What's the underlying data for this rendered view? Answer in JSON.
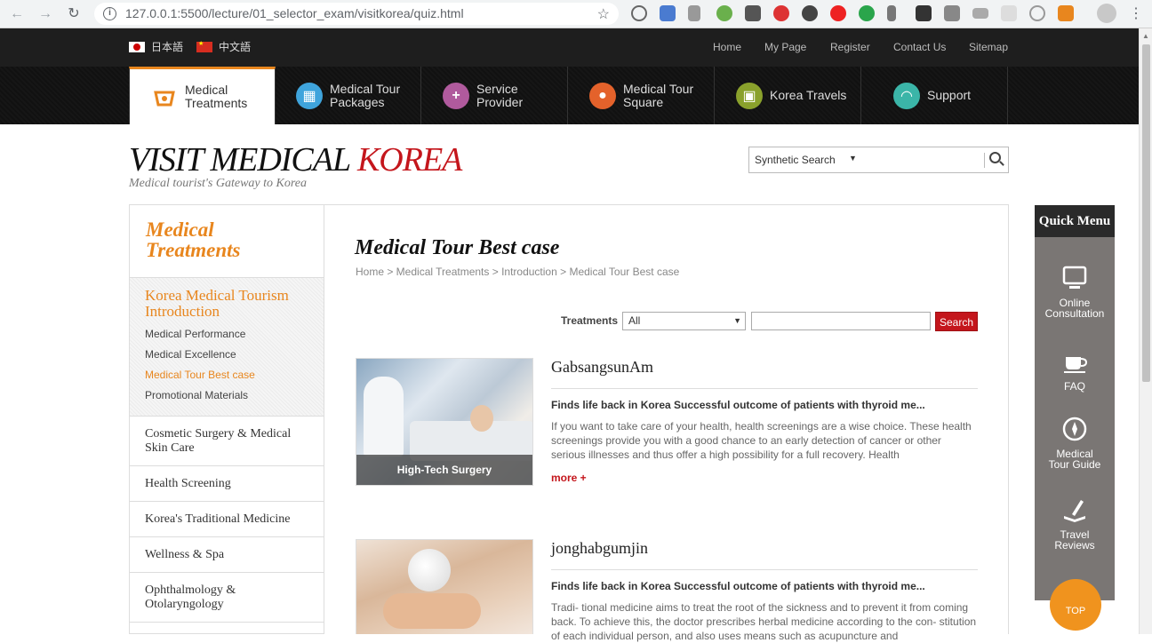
{
  "browser": {
    "url": "127.0.0.1:5500/lecture/01_selector_exam/visitkorea/quiz.html"
  },
  "topbar": {
    "languages": [
      {
        "label": "日本語",
        "flag": "japan-flag-icon"
      },
      {
        "label": "中文語",
        "flag": "china-flag-icon"
      }
    ],
    "links": [
      "Home",
      "My Page",
      "Register",
      "Contact Us",
      "Sitemap"
    ]
  },
  "gnb": [
    {
      "label1": "Medical",
      "label2": "Treatments",
      "icon": "basket-icon",
      "color": "#e8861e",
      "active": true
    },
    {
      "label1": "Medical Tour",
      "label2": "Packages",
      "icon": "gift-icon",
      "color": "#3fa4dc",
      "active": false
    },
    {
      "label1": "Service Provider",
      "label2": "",
      "icon": "plus-icon",
      "color": "#b05a9d",
      "active": false
    },
    {
      "label1": "Medical Tour",
      "label2": "Square",
      "icon": "speech-bubble-icon",
      "color": "#e4622b",
      "active": false
    },
    {
      "label1": "Korea Travels",
      "label2": "",
      "icon": "bus-icon",
      "color": "#8aa12c",
      "active": false
    },
    {
      "label1": "Support",
      "label2": "",
      "icon": "headset-icon",
      "color": "#3bb5a8",
      "active": false
    }
  ],
  "logo": {
    "part1": "VISIT MEDICAL ",
    "part2": "KOREA",
    "tagline": "Medical tourist's Gateway to Korea"
  },
  "synthetic_search": {
    "selected": "Synthetic Search"
  },
  "sidebar": {
    "title_line1": "Medical",
    "title_line2": "Treatments",
    "current_section_line1": "Korea Medical Tourism",
    "current_section_line2": "Introduction",
    "sub_items": [
      "Medical Performance",
      "Medical Excellence",
      "Medical Tour Best case",
      "Promotional Materials"
    ],
    "active_sub": "Medical Tour Best case",
    "items": [
      {
        "line1": "Cosmetic Surgery & Medical",
        "line2": "Skin Care"
      },
      {
        "line1": "Health Screening",
        "line2": ""
      },
      {
        "line1": "Korea's Traditional Medicine",
        "line2": ""
      },
      {
        "line1": "Wellness & Spa",
        "line2": ""
      },
      {
        "line1": "Ophthalmology &",
        "line2": "Otolaryngology"
      }
    ]
  },
  "main": {
    "title": "Medical Tour Best case",
    "breadcrumb": "Home > Medical Treatments > Introduction > Medical Tour Best case",
    "filter": {
      "label": "Treatments",
      "selected": "All",
      "input_value": "",
      "button": "Search"
    },
    "cases": [
      {
        "title": "GabsangsunAm",
        "thumb_caption": "High-Tech Surgery",
        "subtitle": "Finds life back in Korea Successful outcome of patients with thyroid me...",
        "desc": "If you want to take care of your health, health screenings are a wise choice. These health screenings provide you with a good chance to an early detection of cancer or other serious illnesses and thus offer a high possibility for a full recovery. Health",
        "more": "more +"
      },
      {
        "title": "jonghabgumjin",
        "thumb_caption": "",
        "subtitle": "Finds life back in Korea Successful outcome of patients with thyroid me...",
        "desc": "Tradi- tional medicine aims to treat the root of the sickness and to prevent it from coming back. To achieve this, the doctor prescribes herbal medicine according to the con- stitution of each individual person, and also uses means such as acupuncture and",
        "more": ""
      }
    ]
  },
  "quick_menu": {
    "title": "Quick Menu",
    "items": [
      {
        "line1": "Online",
        "line2": "Consultation",
        "icon": "monitor-icon"
      },
      {
        "line1": "FAQ",
        "line2": "",
        "icon": "cup-icon"
      },
      {
        "line1": "Medical",
        "line2": "Tour Guide",
        "icon": "compass-icon"
      },
      {
        "line1": "Travel",
        "line2": "Reviews",
        "icon": "pen-book-icon"
      }
    ],
    "top_label": "TOP"
  }
}
